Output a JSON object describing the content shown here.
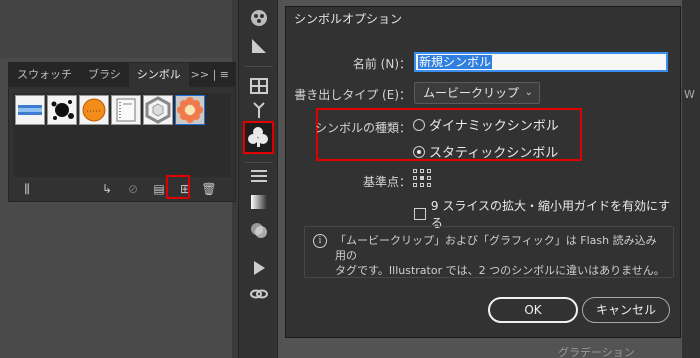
{
  "symbols_panel": {
    "tabs": [
      "スウォッチ",
      "ブラシ",
      "シンボル"
    ],
    "menu": ">> | ≡",
    "footer_icons": [
      "library-icon",
      "place-instance-icon",
      "break-link-icon",
      "symbol-options-icon",
      "new-symbol-icon",
      "delete-icon"
    ]
  },
  "tools": [
    "symbol-sprayer-icon",
    "perspective-icon",
    "grid-icon",
    "puppet-warp-icon",
    "symbols-icon",
    "stroke-icon",
    "gradient-icon",
    "transparency-icon",
    "play-icon",
    "link-icon"
  ],
  "dialog": {
    "title": "シンボルオプション",
    "name_label": "名前 (N)：",
    "name_value": "新規シンボル",
    "export_type_label": "書き出しタイプ (E)：",
    "export_type_value": "ムービークリップ",
    "symbol_type_label": "シンボルの種類：",
    "symbol_type_options": [
      "ダイナミックシンボル",
      "スタティックシンボル"
    ],
    "symbol_type_selected": "スタティックシンボル",
    "registration_label": "基準点：",
    "nine_slice_label": "9 スライスの拡大・縮小用ガイドを有効にする",
    "nine_slice_checked": false,
    "info_text_1": "「ムービークリップ」および「グラフィック」は Flash 読み込み用の",
    "info_text_2": "タグです。Illustrator では、2 つのシンボルに違いはありません。",
    "ok_label": "OK",
    "cancel_label": "キャンセル"
  },
  "background": {
    "right_panel_letter": "W",
    "bottom_panel_label": "グラデーション"
  },
  "colors": {
    "highlight": "#e00000",
    "selection": "#2f7fe0"
  }
}
